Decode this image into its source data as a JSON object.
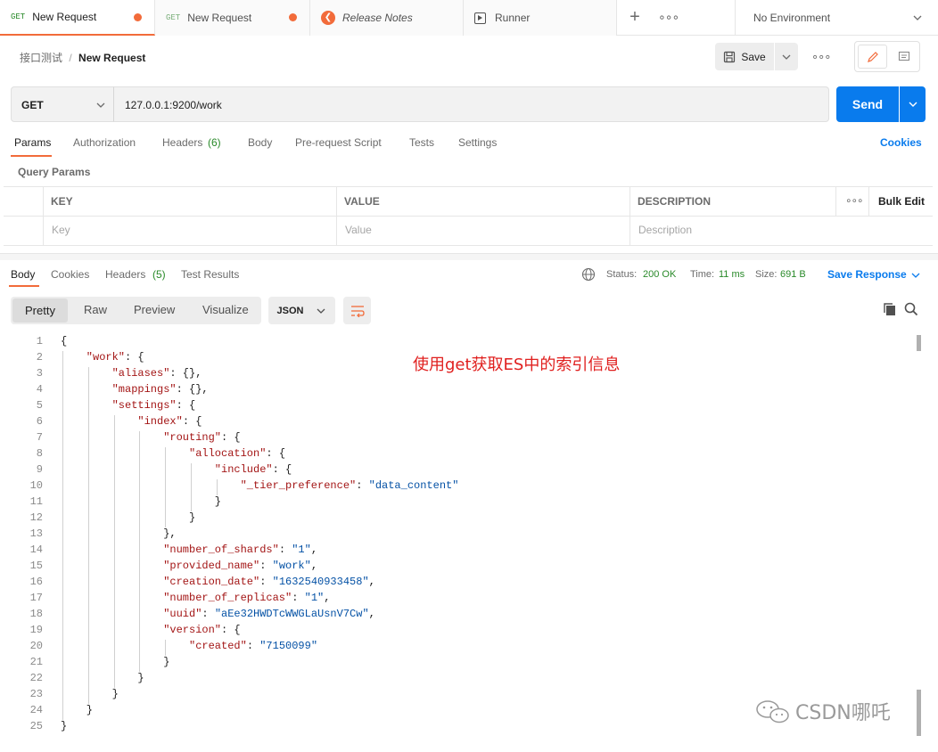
{
  "tabs": [
    {
      "method": "GET",
      "title": "New Request",
      "active": true,
      "unsaved": true
    },
    {
      "method": "GET",
      "title": "New Request",
      "active": false,
      "unsaved": true
    },
    {
      "icon": "release-notes-icon",
      "title": "Release Notes"
    },
    {
      "icon": "runner-icon",
      "title": "Runner"
    }
  ],
  "environment": "No Environment",
  "breadcrumb": {
    "collection": "接口测试",
    "separator": "/",
    "request": "New Request"
  },
  "save_label": "Save",
  "request": {
    "method": "GET",
    "url": "127.0.0.1:9200/work",
    "send_label": "Send"
  },
  "request_tabs": [
    "Params",
    "Authorization",
    "Headers",
    "(6)",
    "Body",
    "Pre-request Script",
    "Tests",
    "Settings"
  ],
  "cookies_label": "Cookies",
  "query_params": {
    "title": "Query Params",
    "columns": [
      "KEY",
      "VALUE",
      "DESCRIPTION"
    ],
    "bulk_edit": "Bulk Edit",
    "placeholders": [
      "Key",
      "Value",
      "Description"
    ]
  },
  "response_tabs": [
    "Body",
    "Cookies",
    "Headers",
    "(5)",
    "Test Results"
  ],
  "status": {
    "status_label": "Status:",
    "status_value": "200 OK",
    "time_label": "Time:",
    "time_value": "11 ms",
    "size_label": "Size:",
    "size_value": "691 B",
    "save_response": "Save Response"
  },
  "view_modes": [
    "Pretty",
    "Raw",
    "Preview",
    "Visualize"
  ],
  "format": "JSON",
  "annotation": "使用get获取ES中的索引信息",
  "watermark": "CSDN哪吒",
  "json_lines": [
    [
      {
        "t": "{"
      }
    ],
    [
      {
        "t": "\"work\"",
        "c": "k"
      },
      {
        "t": ": {"
      }
    ],
    [
      {
        "t": "\"aliases\"",
        "c": "k"
      },
      {
        "t": ": {},"
      }
    ],
    [
      {
        "t": "\"mappings\"",
        "c": "k"
      },
      {
        "t": ": {},"
      }
    ],
    [
      {
        "t": "\"settings\"",
        "c": "k"
      },
      {
        "t": ": {"
      }
    ],
    [
      {
        "t": "\"index\"",
        "c": "k"
      },
      {
        "t": ": {"
      }
    ],
    [
      {
        "t": "\"routing\"",
        "c": "k"
      },
      {
        "t": ": {"
      }
    ],
    [
      {
        "t": "\"allocation\"",
        "c": "k"
      },
      {
        "t": ": {"
      }
    ],
    [
      {
        "t": "\"include\"",
        "c": "k"
      },
      {
        "t": ": {"
      }
    ],
    [
      {
        "t": "\"_tier_preference\"",
        "c": "k"
      },
      {
        "t": ": "
      },
      {
        "t": "\"data_content\"",
        "c": "s"
      }
    ],
    [
      {
        "t": "}"
      }
    ],
    [
      {
        "t": "}"
      }
    ],
    [
      {
        "t": "},"
      }
    ],
    [
      {
        "t": "\"number_of_shards\"",
        "c": "k"
      },
      {
        "t": ": "
      },
      {
        "t": "\"1\"",
        "c": "s"
      },
      {
        "t": ","
      }
    ],
    [
      {
        "t": "\"provided_name\"",
        "c": "k"
      },
      {
        "t": ": "
      },
      {
        "t": "\"work\"",
        "c": "s"
      },
      {
        "t": ","
      }
    ],
    [
      {
        "t": "\"creation_date\"",
        "c": "k"
      },
      {
        "t": ": "
      },
      {
        "t": "\"1632540933458\"",
        "c": "s"
      },
      {
        "t": ","
      }
    ],
    [
      {
        "t": "\"number_of_replicas\"",
        "c": "k"
      },
      {
        "t": ": "
      },
      {
        "t": "\"1\"",
        "c": "s"
      },
      {
        "t": ","
      }
    ],
    [
      {
        "t": "\"uuid\"",
        "c": "k"
      },
      {
        "t": ": "
      },
      {
        "t": "\"aEe32HWDTcWWGLaUsnV7Cw\"",
        "c": "s"
      },
      {
        "t": ","
      }
    ],
    [
      {
        "t": "\"version\"",
        "c": "k"
      },
      {
        "t": ": {"
      }
    ],
    [
      {
        "t": "\"created\"",
        "c": "k"
      },
      {
        "t": ": "
      },
      {
        "t": "\"7150099\"",
        "c": "s"
      }
    ],
    [
      {
        "t": "}"
      }
    ],
    [
      {
        "t": "}"
      }
    ],
    [
      {
        "t": "}"
      }
    ],
    [
      {
        "t": "}"
      }
    ],
    [
      {
        "t": "}"
      }
    ]
  ]
}
